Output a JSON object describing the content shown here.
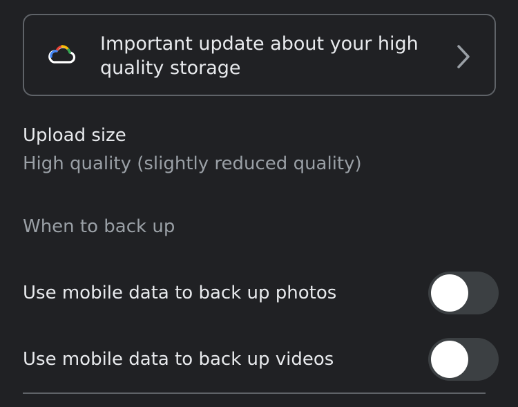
{
  "banner": {
    "icon": "cloud-icon",
    "text": "Important update about your high quality storage",
    "chevron": "chevron-right-icon"
  },
  "upload_size": {
    "title": "Upload size",
    "value": "High quality (slightly reduced quality)"
  },
  "when_to_back_up": {
    "header": "When to back up"
  },
  "toggles": [
    {
      "label": "Use mobile data to back up photos",
      "on": false
    },
    {
      "label": "Use mobile data to back up videos",
      "on": false
    }
  ],
  "colors": {
    "background": "#202124",
    "text_primary": "#e8eaed",
    "text_secondary": "#9aa0a6",
    "border": "#5f6368",
    "toggle_track_off": "#3c4043"
  }
}
